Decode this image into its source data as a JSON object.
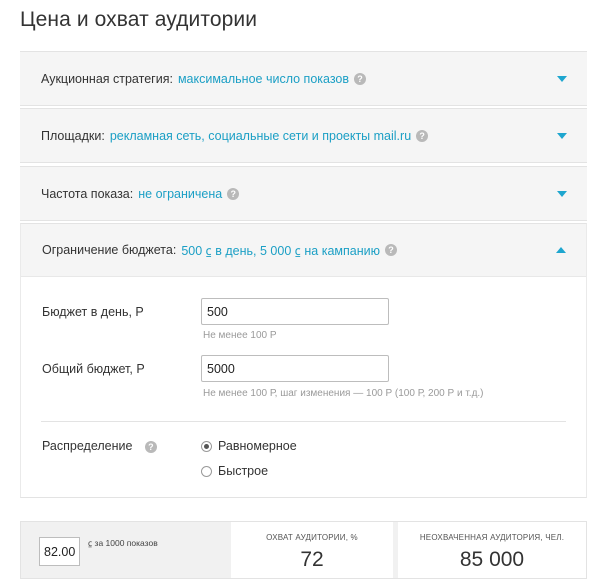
{
  "page": {
    "title": "Цена и охват аудитории"
  },
  "sections": [
    {
      "label": "Аукционная стратегия:",
      "value": "максимальное число показов",
      "help": "?",
      "expanded": false
    },
    {
      "label": "Площадки:",
      "value": "рекламная сеть, социальные сети и проекты mail.ru",
      "help": "?",
      "expanded": false
    },
    {
      "label": "Частота показа:",
      "value": "не ограничена",
      "help": "?",
      "expanded": false
    },
    {
      "label": "Ограничение бюджета:",
      "value": "500 ⃀ в день, 5 000 ⃀ на кампанию",
      "help": "?",
      "expanded": true
    }
  ],
  "budget": {
    "daily_label": "Бюджет в день, Р",
    "daily_value": "500",
    "daily_hint": "Не менее 100 Р",
    "total_label": "Общий бюджет, Р",
    "total_value": "5000",
    "total_hint": "Не менее 100 Р, шаг изменения — 100 Р (100 Р, 200 Р и т.д.)",
    "distribution_label": "Распределение",
    "distribution_help": "?",
    "options": [
      {
        "label": "Равномерное",
        "selected": true
      },
      {
        "label": "Быстрое",
        "selected": false
      }
    ]
  },
  "summary": {
    "rate_value": "82.00",
    "rate_caption": "⃀ за 1000 показов",
    "reach_title": "ОХВАТ АУДИТОРИИ, %",
    "reach_value": "72",
    "unreached_title": "НЕОХВАЧЕННАЯ АУДИТОРИЯ, ЧЕЛ.",
    "unreached_value": "85 000"
  },
  "colors": {
    "accent": "#1b9fc5",
    "panel_bg": "#f5f5f5",
    "help_icon": "#b9b9b9"
  }
}
